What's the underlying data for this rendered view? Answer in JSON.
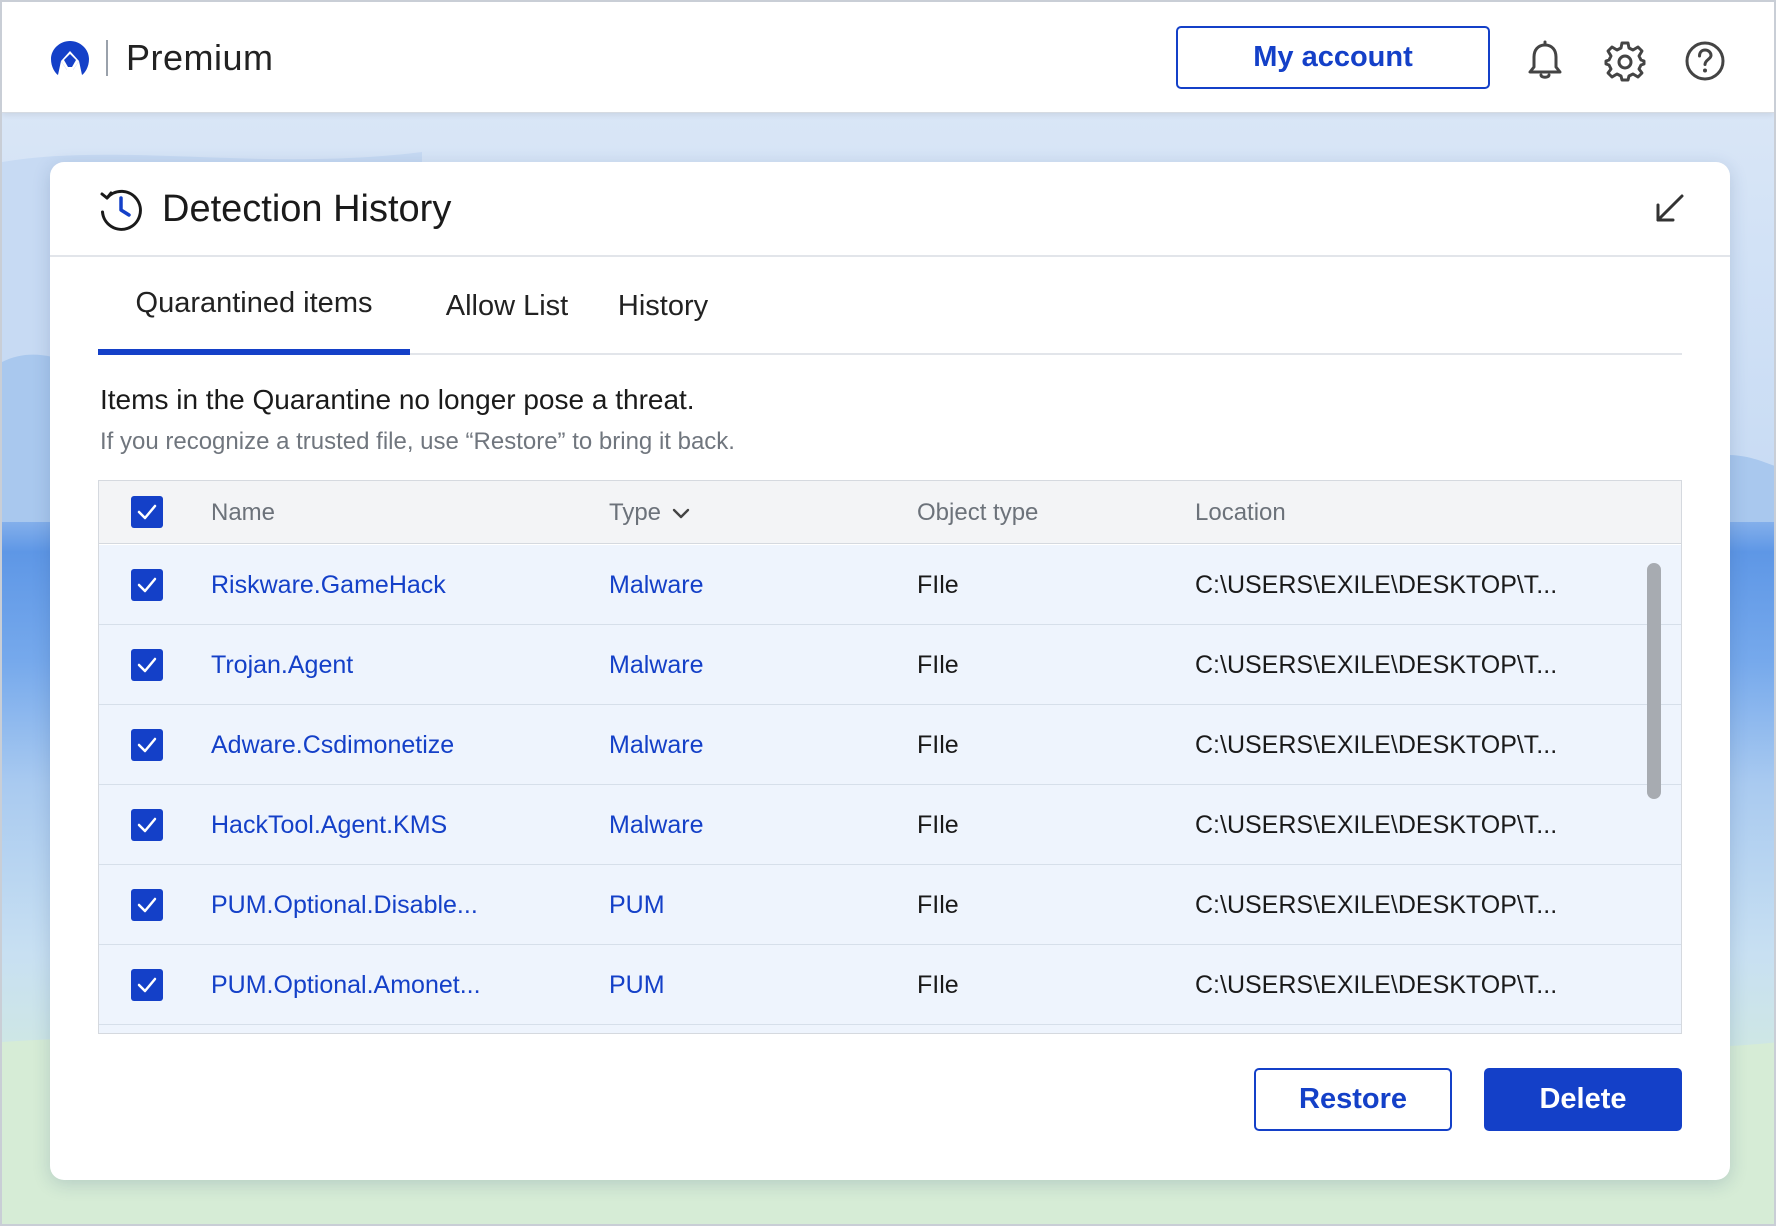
{
  "app": {
    "product_name": "Premium",
    "my_account_label": "My account",
    "accent_color": "#1440c8"
  },
  "panel": {
    "title": "Detection History"
  },
  "tabs": [
    {
      "label": "Quarantined items",
      "active": true
    },
    {
      "label": "Allow List",
      "active": false
    },
    {
      "label": "History",
      "active": false
    }
  ],
  "description": {
    "main": "Items in the Quarantine no longer pose a threat.",
    "sub": "If you recognize a trusted file, use “Restore” to bring it back."
  },
  "table": {
    "select_all_checked": true,
    "columns": {
      "name": "Name",
      "type": "Type",
      "object_type": "Object type",
      "location": "Location"
    },
    "rows": [
      {
        "checked": true,
        "name": "Riskware.GameHack",
        "type": "Malware",
        "object_type": "FIle",
        "location": "C:\\USERS\\EXILE\\DESKTOP\\T..."
      },
      {
        "checked": true,
        "name": "Trojan.Agent",
        "type": "Malware",
        "object_type": "FIle",
        "location": "C:\\USERS\\EXILE\\DESKTOP\\T..."
      },
      {
        "checked": true,
        "name": "Adware.Csdimonetize",
        "type": "Malware",
        "object_type": "FIle",
        "location": "C:\\USERS\\EXILE\\DESKTOP\\T..."
      },
      {
        "checked": true,
        "name": "HackTool.Agent.KMS",
        "type": "Malware",
        "object_type": "FIle",
        "location": "C:\\USERS\\EXILE\\DESKTOP\\T..."
      },
      {
        "checked": true,
        "name": "PUM.Optional.Disable...",
        "type": "PUM",
        "object_type": "FIle",
        "location": "C:\\USERS\\EXILE\\DESKTOP\\T..."
      },
      {
        "checked": true,
        "name": "PUM.Optional.Amonet...",
        "type": "PUM",
        "object_type": "FIle",
        "location": "C:\\USERS\\EXILE\\DESKTOP\\T..."
      }
    ]
  },
  "actions": {
    "restore_label": "Restore",
    "delete_label": "Delete"
  },
  "icons": {
    "logo": "malwarebytes-logo",
    "notifications": "bell-icon",
    "settings": "gear-icon",
    "help": "help-icon",
    "history": "history-clock-icon",
    "collapse": "collapse-arrow-icon",
    "sort": "chevron-down-icon",
    "check": "checkmark-icon"
  }
}
